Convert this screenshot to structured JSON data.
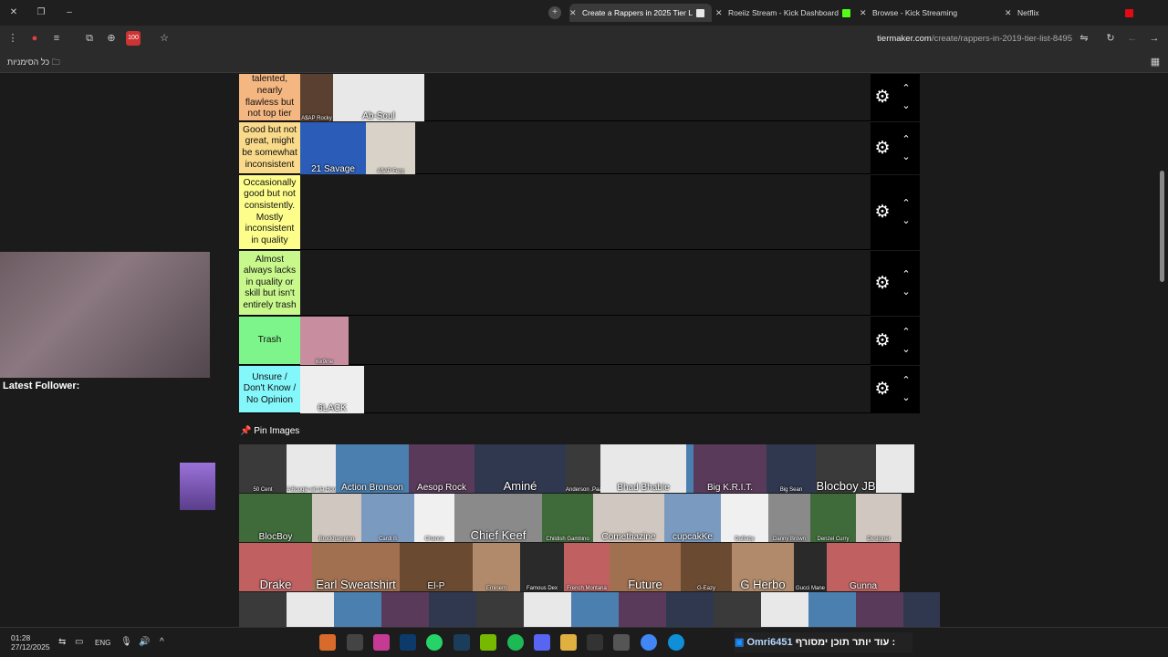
{
  "browser": {
    "tabs": [
      {
        "label": "Create a Rappers in 2025 Tier L",
        "active": true
      },
      {
        "label": "Roeiiz Stream - Kick Dashboard",
        "active": false
      },
      {
        "label": "Browse - Kick Streaming",
        "active": false
      },
      {
        "label": "Netflix",
        "active": false
      }
    ],
    "url_host": "tiermaker.com",
    "url_path": "/create/rappers-in-2019-tier-list-8495",
    "bookmarks_label": "כל הסימניות",
    "ext_badge": "100"
  },
  "overlay": {
    "latest_follower_label": "Latest Follower:"
  },
  "tiers": [
    {
      "label": "talented, nearly flawless but not top tier",
      "color": "#f4b782",
      "items": [
        "A$AP Rocky",
        "Ab-Soul"
      ]
    },
    {
      "label": "Good but not great, might be somewhat inconsistent",
      "color": "#f9d98a",
      "items": [
        "21 Savage",
        "A$AP Ferg"
      ]
    },
    {
      "label": "Occasionally good but not consistently. Mostly inconsistent in quality",
      "color": "#fdfd8c",
      "items": []
    },
    {
      "label": "Almost always lacks in quality or skill but isn't entirely trash",
      "color": "#c8f88c",
      "items": []
    },
    {
      "label": "Trash",
      "color": "#7ef58a",
      "items": [
        "6ix9ine"
      ]
    },
    {
      "label": "Unsure / Don't Know / No Opinion",
      "color": "#84f7fb",
      "items": [
        "6LACK"
      ]
    }
  ],
  "pin_images": {
    "title": "Pin Images",
    "rows": [
      [
        "50 Cent",
        "A Boogie wit da Hoodie",
        "Action Bronson",
        "Aesop Rock",
        "Aminé",
        "Anderson .Paak",
        "Bhad Bhabie",
        "",
        "Big K.R.I.T.",
        "Big Sean",
        "Blocboy JB",
        ""
      ],
      [
        "BlocBoy",
        "Brockhampton",
        "Cardi B",
        "Chance",
        "Chief Keef",
        "Childish Gambino",
        "Comethazine",
        "cupcakKe",
        "DaBaby",
        "Danny Brown",
        "Denzel Curry",
        "Desiigner"
      ],
      [
        "Drake",
        "Earl Sweatshirt",
        "El-P",
        "Eminem",
        "Famous Dex",
        "French Montana",
        "Future",
        "G-Eazy",
        "G Herbo",
        "Gucci Mane",
        "Gunna"
      ],
      [
        "",
        "",
        "",
        "",
        "",
        "",
        "",
        "",
        "",
        "",
        "",
        "",
        "",
        "",
        ""
      ]
    ]
  },
  "taskbar": {
    "time": "01:28",
    "date": "27/12/2025",
    "lang": "ENG",
    "banner_user": "Omri6451",
    "banner_text": "עוד יותר תוכן ימסורף :"
  }
}
